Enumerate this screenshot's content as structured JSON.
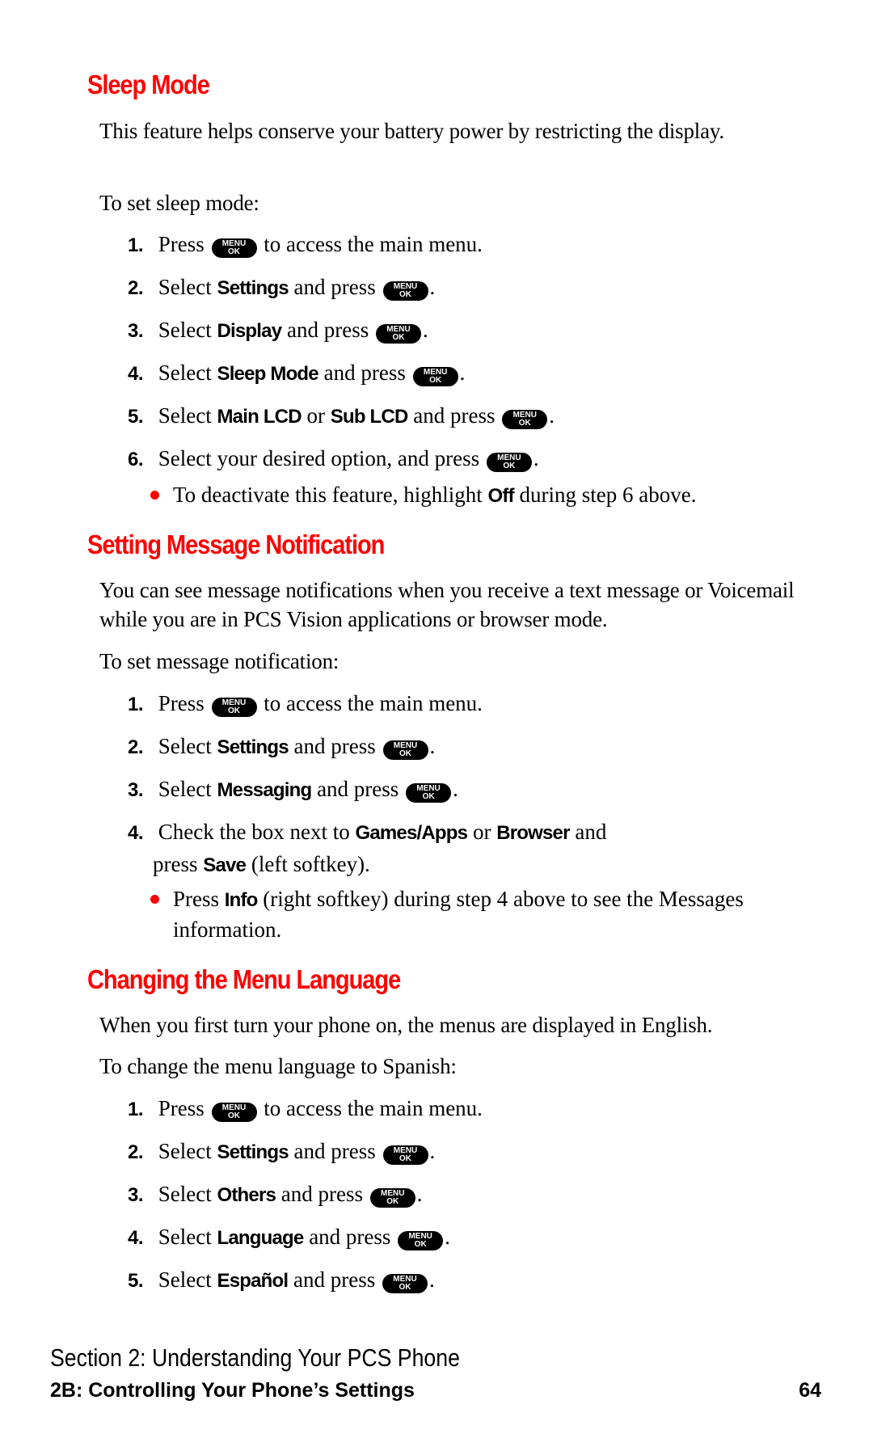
{
  "key_icon": {
    "name": "menu-ok-key-icon",
    "line1": "MENU",
    "line2": "OK"
  },
  "bullet_color": "#ff0000",
  "heading_color": "#ff0000",
  "sections": {
    "sleep_mode": {
      "title": "Sleep Mode",
      "intro": "This feature helps conserve your battery power by restricting the display.",
      "lead": "To set sleep mode:",
      "steps": [
        {
          "num": "1.",
          "pre": "Press",
          "post": "to access the main menu."
        },
        {
          "num": "2.",
          "pre": "Select",
          "bold": "Settings",
          "mid": "and press",
          "post": "."
        },
        {
          "num": "3.",
          "pre": "Select",
          "bold": "Display",
          "mid": "and press",
          "post": "."
        },
        {
          "num": "4.",
          "pre": "Select",
          "bold": "Sleep Mode",
          "mid": "and press",
          "post": "."
        },
        {
          "num": "5.",
          "pre": "Select",
          "bold": "Main LCD",
          "or": "or",
          "bold2": "Sub LCD",
          "mid": "and press",
          "post": "."
        },
        {
          "num": "6.",
          "pre": "Select your desired option, and press",
          "post": "."
        }
      ],
      "bullet": {
        "pre": "To deactivate this feature, highlight",
        "bold": "Off",
        "post": "during step 6 above."
      }
    },
    "message_notification": {
      "title": "Setting Message Notification",
      "intro": "You can see message notifications when you receive a text message or Voicemail while you are in PCS Vision applications or browser mode.",
      "lead": "To set message notification:",
      "steps": [
        {
          "num": "1.",
          "pre": "Press",
          "post": "to access the main menu."
        },
        {
          "num": "2.",
          "pre": "Select",
          "bold": "Settings",
          "mid": "and press",
          "post": "."
        },
        {
          "num": "3.",
          "pre": "Select",
          "bold": "Messaging",
          "mid": "and press",
          "post": "."
        },
        {
          "num": "4.",
          "pre": "Check the box next to",
          "bold": "Games/Apps",
          "or": "or",
          "bold2": "Browser",
          "mid": "and",
          "line2_pre": "press",
          "line2_bold": "Save",
          "line2_post": "(left softkey)."
        }
      ],
      "bullet": {
        "pre": "Press",
        "bold": "Info",
        "post": "(right softkey) during step 4 above to see the Messages information."
      }
    },
    "menu_language": {
      "title": "Changing the Menu Language",
      "intro": "When you first turn your phone on, the menus are displayed in English.",
      "lead": "To change the menu language to Spanish:",
      "steps": [
        {
          "num": "1.",
          "pre": "Press",
          "post": "to access the main menu."
        },
        {
          "num": "2.",
          "pre": "Select",
          "bold": "Settings",
          "mid": "and press",
          "post": "."
        },
        {
          "num": "3.",
          "pre": "Select",
          "bold": "Others",
          "mid": "and press",
          "post": "."
        },
        {
          "num": "4.",
          "pre": "Select",
          "bold": "Language",
          "mid": "and press",
          "post": "."
        },
        {
          "num": "5.",
          "pre": "Select",
          "bold": "Español",
          "mid": "and press",
          "post": "."
        }
      ]
    }
  },
  "footer": {
    "section": "Section 2: Understanding Your PCS Phone",
    "chapter": "2B: Controlling Your Phone’s Settings",
    "page_number": "64"
  }
}
